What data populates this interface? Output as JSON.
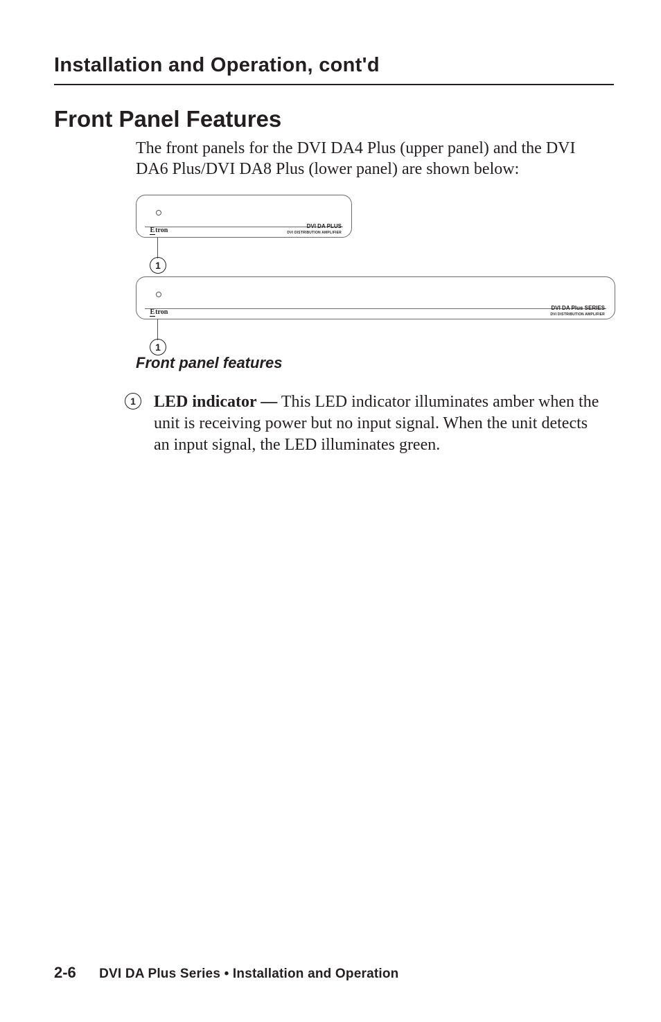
{
  "running_head": "Installation and Operation, cont'd",
  "h1": "Front Panel Features",
  "intro": "The front panels for the DVI DA4 Plus (upper panel) and the DVI DA6 Plus/DVI DA8 Plus (lower panel) are shown below:",
  "panels": {
    "brand_left": "E",
    "brand_right": "tron",
    "small": {
      "model": "DVI DA PLUS",
      "sub": "DVI DISTRIBUTION AMPLIFIER",
      "callout_number": "1"
    },
    "wide": {
      "model": "DVI DA Plus SERIES",
      "sub": "DVI DISTRIBUTION AMPLIFIER",
      "callout_number": "1"
    }
  },
  "figure_caption": "Front panel features",
  "feature": {
    "number": "1",
    "lead": "LED indicator —",
    "body_rest": " This LED indicator illuminates amber when the unit is receiving power but no input signal.  When the unit detects an input signal, the LED illuminates green."
  },
  "footer": {
    "page": "2-6",
    "title": "DVI DA Plus Series • Installation and Operation"
  }
}
